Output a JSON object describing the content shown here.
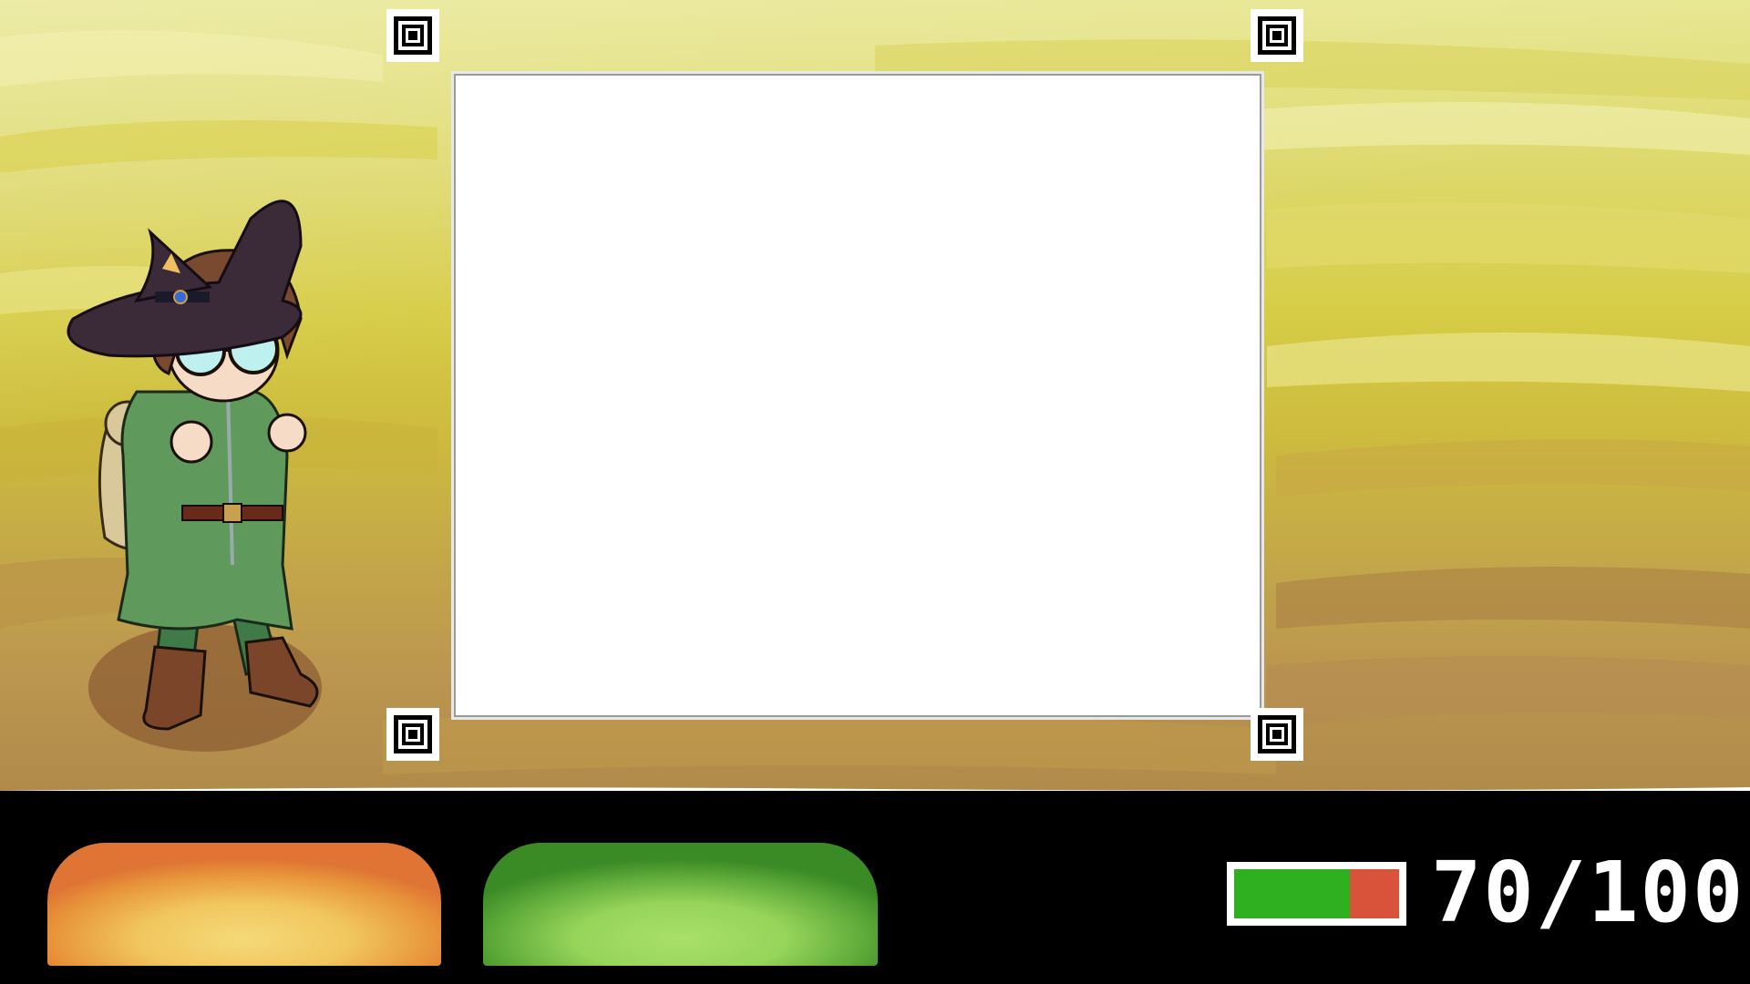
{
  "hud": {
    "hp_text": "70/100",
    "hp_value": 70,
    "hp_max": 100,
    "hp_fill_color": "#2fb021",
    "hp_empty_color": "#d9533a"
  },
  "buttons": [
    {
      "id": "orange",
      "color": "#df7434"
    },
    {
      "id": "green",
      "color": "#3a8a26"
    }
  ],
  "character": {
    "name_icon": "witch-adventurer-sprite"
  },
  "arena": {
    "marker_icon": "fiducial-marker-icon"
  }
}
